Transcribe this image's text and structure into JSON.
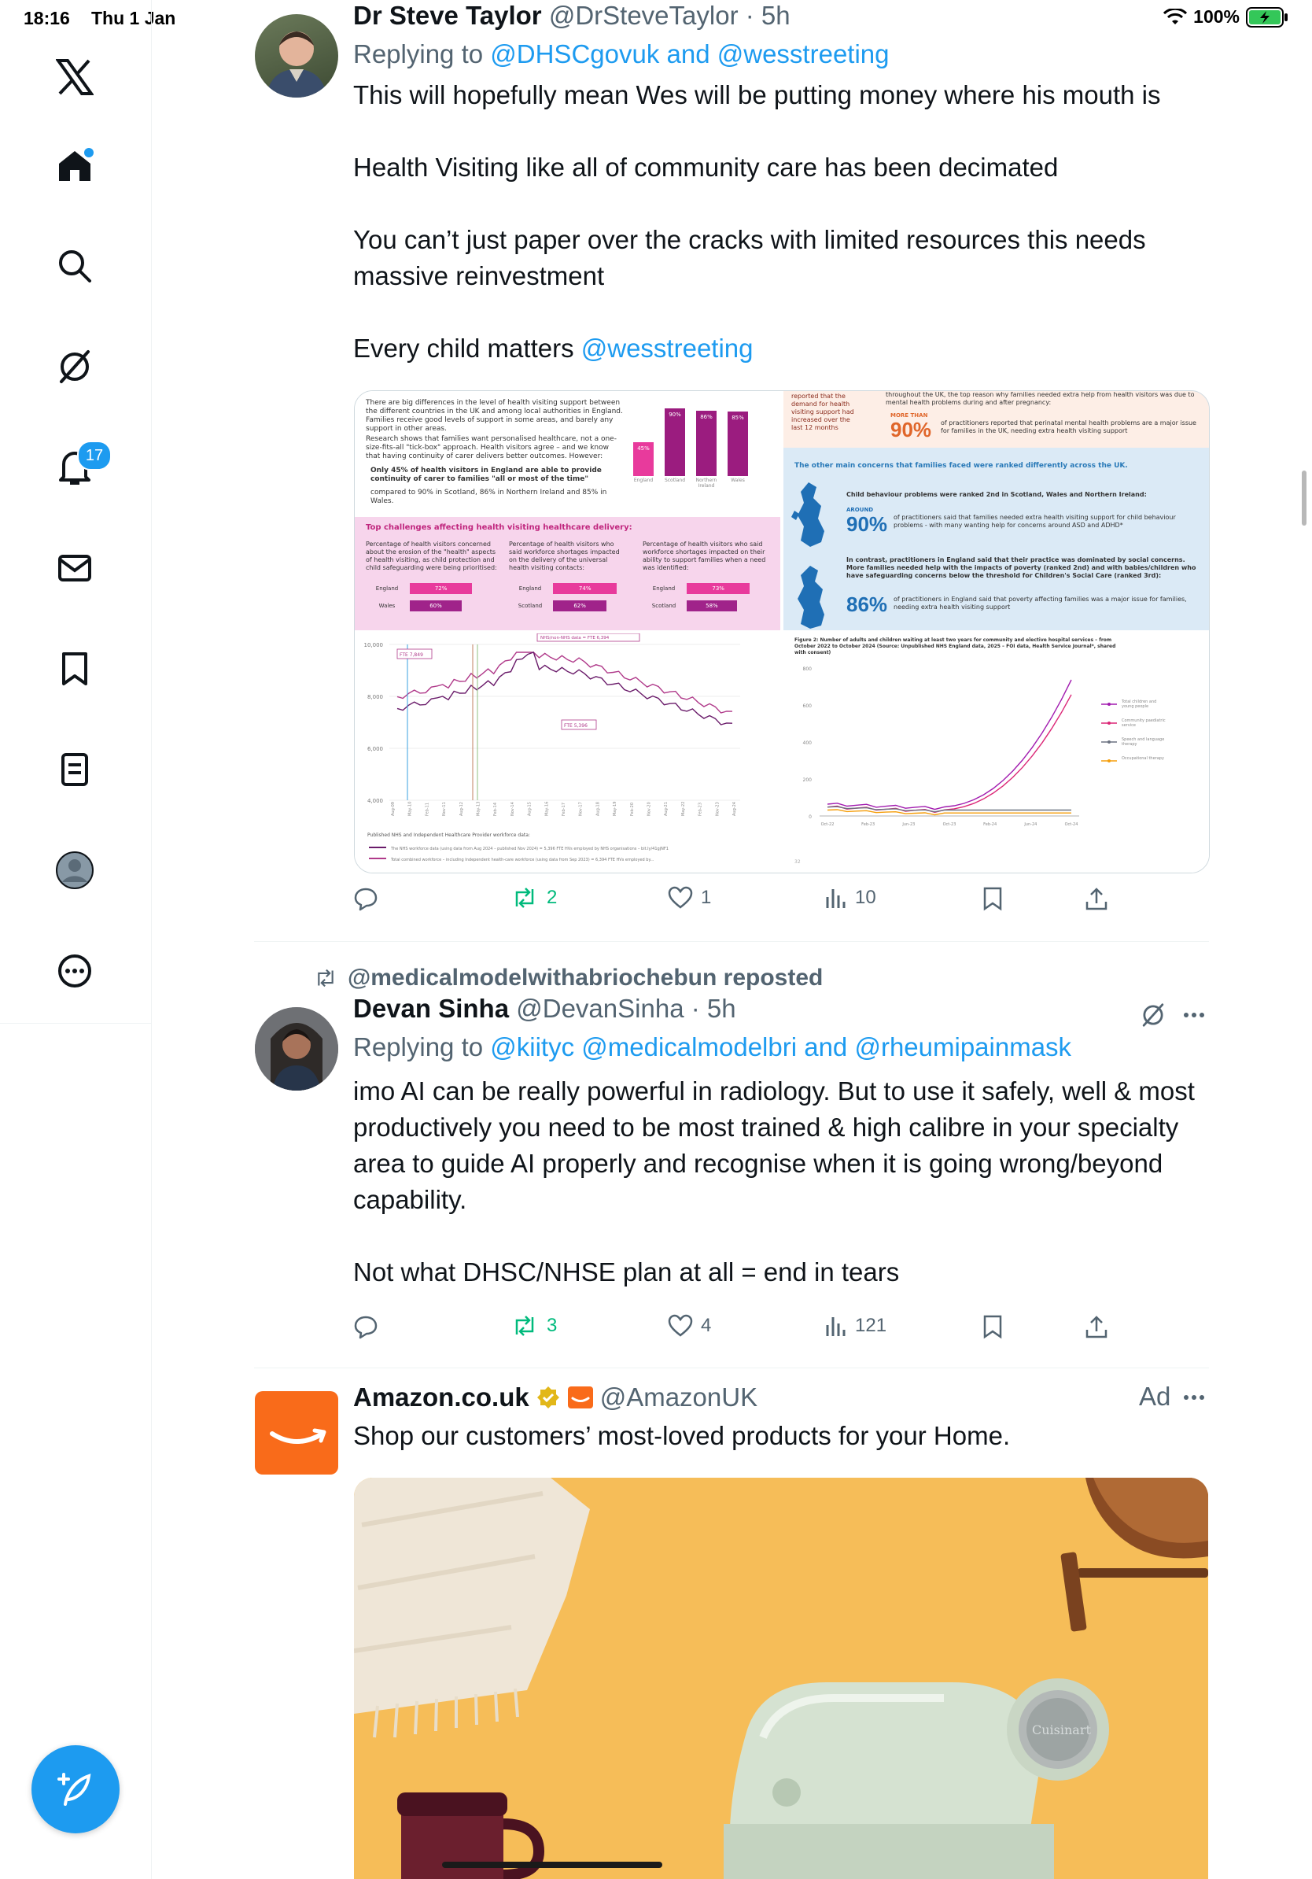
{
  "status_bar": {
    "time": "18:16",
    "date": "Thu 1 Jan",
    "battery": "100%"
  },
  "sidebar": {
    "items": [
      "x-logo",
      "home",
      "search",
      "grok",
      "notifications",
      "messages",
      "bookmarks",
      "lists",
      "profile",
      "more"
    ],
    "notifications_badge": "17"
  },
  "tweets": [
    {
      "name": "Dr Steve Taylor",
      "handle": "@DrSteveTaylor",
      "time": "· 5h",
      "replying_prefix": "Replying to ",
      "replying_a": "@DHSCgovuk",
      "replying_and": " and ",
      "replying_b": "@wesstreeting",
      "text": [
        "This will hopefully mean Wes will be putting money where his mouth is",
        "Health Visiting like all of community care has been decimated",
        "You can’t just paper over the cracks with limited resources this needs massive reinvestment",
        "Every child matters "
      ],
      "mention": "@wesstreeting",
      "stats": {
        "replies": "",
        "reposts": "2",
        "likes": "1",
        "views": "10"
      },
      "media": {
        "q1": {
          "intro": "There are big differences in the level of health visiting support between the different countries in the UK and among local authorities in England. Families receive good levels of support in some areas, and barely any support in other areas.",
          "research": "Research shows that families want personalised healthcare, not a one-size-fits-all \"tick-box\" approach. Health visitors agree – and we know that having continuity of carer delivers better outcomes. However:",
          "bullet1": "Only 45% of health visitors in England are able to provide continuity of carer to families \"all or most of the time\"",
          "bullet2": "compared to 90% in Scotland, 86% in Northern Ireland and 85% in Wales.",
          "bars": [
            {
              "label": "England",
              "value": "45%",
              "pct": 45
            },
            {
              "label": "Scotland",
              "value": "90%",
              "pct": 90
            },
            {
              "label": "Northern Ireland",
              "value": "86%",
              "pct": 86
            },
            {
              "label": "Wales",
              "value": "85%",
              "pct": 85
            }
          ],
          "challenges_title": "Top challenges affecting health visiting healthcare delivery:",
          "col1": "Percentage of health visitors concerned about the erosion of the \"health\" aspects of health visiting, as child protection and child safeguarding were being prioritised:",
          "col2": "Percentage of health visitors who said workforce shortages impacted on the delivery of the universal health visiting contacts:",
          "col3": "Percentage of health visitors who said workforce shortages impacted on their ability to support families when a need was identified:",
          "rows1": [
            {
              "label": "England",
              "value": "72%",
              "pct": 72
            },
            {
              "label": "Wales",
              "value": "60%",
              "pct": 60
            }
          ],
          "rows2": [
            {
              "label": "England",
              "value": "74%",
              "pct": 74
            },
            {
              "label": "Scotland",
              "value": "62%",
              "pct": 62
            }
          ],
          "rows3": [
            {
              "label": "England",
              "value": "73%",
              "pct": 73
            },
            {
              "label": "Scotland",
              "value": "58%",
              "pct": 58
            }
          ]
        },
        "q2": {
          "left_text": "reported that the demand for health visiting support had increased over the last 12 months",
          "top_text": "throughout the UK, the top reason why families needed extra help from health visitors was due to mental health problems during and after pregnancy:",
          "more_than": "MORE THAN",
          "stat1": "90%",
          "stat1_text": "of practitioners reported that perinatal mental health problems are a major issue for families in the UK, needing extra health visiting support",
          "band": "The other main concerns that families faced were ranked differently across the UK.",
          "child_title": "Child behaviour problems were ranked 2nd in Scotland, Wales and Northern Ireland:",
          "around": "AROUND",
          "stat2": "90%",
          "stat2_text": "of practitioners said that families needed extra health visiting support for child behaviour problems - with many wanting help for concerns around ASD and ADHD*",
          "england_text": "In contrast, practitioners in England said that their practice was dominated by social concerns. More families needed help with the impacts of poverty (ranked 2nd) and with babies/children who have safeguarding concerns below the threshold for Children's Social Care (ranked 3rd):",
          "stat3": "86%",
          "stat3_text": "of practitioners in England said that poverty affecting families was a major issue for families, needing extra health visiting support"
        },
        "q3": {
          "chart_data": {
            "type": "line",
            "y_ticks": [
              "10,000",
              "8,000",
              "6,000",
              "4,000"
            ],
            "annotation_a": "FTE 7,849",
            "annotation_b": "FTE 5,396",
            "annotation_c": "NHS/non-NHS data = FTE 6,394",
            "x_labels": [
              "Aug-09",
              "May-10",
              "Feb-11",
              "Nov-11",
              "Aug-12",
              "May-13",
              "Feb-14",
              "Nov-14",
              "Aug-15",
              "May-16",
              "Feb-17",
              "Nov-17",
              "Aug-18",
              "May-19",
              "Feb-20",
              "Nov-20",
              "Aug-21",
              "May-22",
              "Feb-23",
              "Nov-23",
              "Aug-24"
            ],
            "footer_title": "Published NHS and Independent Healthcare Provider workforce data:",
            "legend1": "The NHS workforce data (using data from Aug 2024 – published Nov 2024) = 5,396 FTE HVs employed by NHS organisations – bit.ly/41gjNF1",
            "legend2": "Total combined workforce – including Independent health-care workforce (using data from Sep 2023) = 6,394 FTE HVs employed by..."
          }
        },
        "q4": {
          "chart_data": {
            "type": "line",
            "title": "Figure 2: Number of adults and children waiting at least two years for community and elective hospital services – from October 2022 to October 2024 (Source: Unpublished NHS England data, 2025 – FOI data, Health Service Journal*, shared with consent)",
            "y_ticks": [
              "800",
              "600",
              "400",
              "200",
              "0"
            ],
            "x_labels": [
              "Oct-22",
              "Feb-23",
              "Jun-23",
              "Oct-23",
              "Feb-24",
              "Jun-24",
              "Oct-24"
            ],
            "series": [
              {
                "name": "Total children and young people",
                "color": "#a21caf"
              },
              {
                "name": "Community paediatric service",
                "color": "#db2777"
              },
              {
                "name": "Speech and language therapy",
                "color": "#6b7280"
              },
              {
                "name": "Occupational therapy",
                "color": "#f59e0b"
              }
            ],
            "footer_num": "32"
          }
        }
      }
    },
    {
      "repost_line": "@medicalmodelwithabriochebun reposted",
      "name": "Devan Sinha",
      "handle": "@DevanSinha",
      "time": "· 5h",
      "replying_prefix": "Replying to ",
      "replying_a": "@kiityc",
      "replying_b": "@medicalmodelbri",
      "replying_and": " and ",
      "replying_c": "@rheumipainmask",
      "text": [
        "imo AI can be really powerful in radiology. But to use it safely, well & most productively you need to be most trained & high calibre in your specialty area to guide AI properly and recognise when it is going wrong/beyond capability.",
        "Not what DHSC/NHSE plan at all = end in tears"
      ],
      "stats": {
        "replies": "",
        "reposts": "3",
        "likes": "4",
        "views": "121"
      }
    },
    {
      "name": "Amazon.co.uk",
      "handle": "@AmazonUK",
      "ad_label": "Ad",
      "text": "Shop our customers’ most-loved products for your Home.",
      "product_brand": "Cuisinart"
    }
  ]
}
